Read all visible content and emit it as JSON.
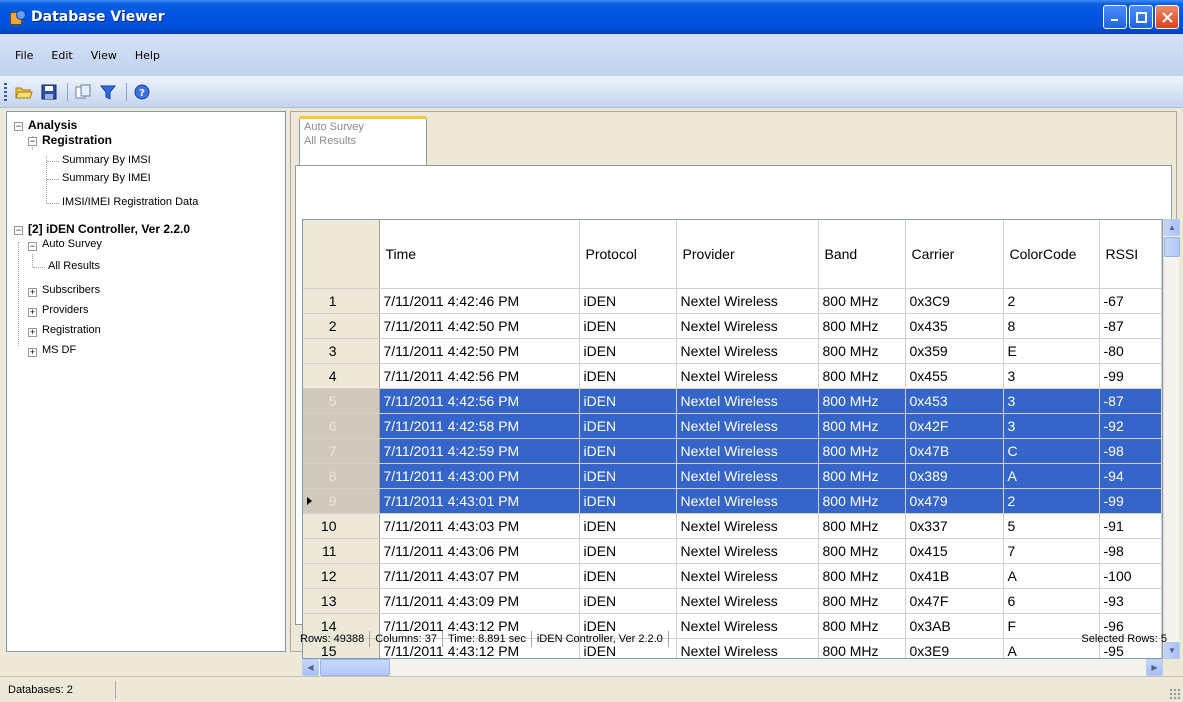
{
  "window": {
    "title": "Database Viewer",
    "minimize": "_",
    "maximize": "□",
    "close": "✕"
  },
  "menu": [
    "File",
    "Edit",
    "View",
    "Help"
  ],
  "toolbar": [
    "open-icon",
    "save-icon",
    "copy-icon",
    "filter-icon",
    "help-icon"
  ],
  "tree": {
    "analysis": "Analysis",
    "registration": "Registration",
    "summary_imsi": "Summary By IMSI",
    "summary_imei": "Summary By IMEI",
    "imsi_imei_reg": "IMSI/IMEI Registration Data",
    "controller": "[2]  iDEN Controller, Ver 2.2.0",
    "auto_survey": "Auto Survey",
    "all_results": "All Results",
    "subscribers": "Subscribers",
    "providers": "Providers",
    "registration2": "Registration",
    "ms_df": "MS DF"
  },
  "tab": {
    "line1": "Auto Survey",
    "line2": "All Results"
  },
  "grid": {
    "columns": [
      "Time",
      "Protocol",
      "Provider",
      "Band",
      "Carrier",
      "ColorCode",
      "RSSI"
    ],
    "rows": [
      {
        "n": "1",
        "time": "7/11/2011 4:42:46 PM",
        "protocol": "iDEN",
        "provider": "Nextel Wireless",
        "band": "800 MHz",
        "carrier": "0x3C9",
        "color": "2",
        "rssi": "-67",
        "selected": false
      },
      {
        "n": "2",
        "time": "7/11/2011 4:42:50 PM",
        "protocol": "iDEN",
        "provider": "Nextel Wireless",
        "band": "800 MHz",
        "carrier": "0x435",
        "color": "8",
        "rssi": "-87",
        "selected": false
      },
      {
        "n": "3",
        "time": "7/11/2011 4:42:50 PM",
        "protocol": "iDEN",
        "provider": "Nextel Wireless",
        "band": "800 MHz",
        "carrier": "0x359",
        "color": "E",
        "rssi": "-80",
        "selected": false
      },
      {
        "n": "4",
        "time": "7/11/2011 4:42:56 PM",
        "protocol": "iDEN",
        "provider": "Nextel Wireless",
        "band": "800 MHz",
        "carrier": "0x455",
        "color": "3",
        "rssi": "-99",
        "selected": false
      },
      {
        "n": "5",
        "time": "7/11/2011 4:42:56 PM",
        "protocol": "iDEN",
        "provider": "Nextel Wireless",
        "band": "800 MHz",
        "carrier": "0x453",
        "color": "3",
        "rssi": "-87",
        "selected": true
      },
      {
        "n": "6",
        "time": "7/11/2011 4:42:58 PM",
        "protocol": "iDEN",
        "provider": "Nextel Wireless",
        "band": "800 MHz",
        "carrier": "0x42F",
        "color": "3",
        "rssi": "-92",
        "selected": true
      },
      {
        "n": "7",
        "time": "7/11/2011 4:42:59 PM",
        "protocol": "iDEN",
        "provider": "Nextel Wireless",
        "band": "800 MHz",
        "carrier": "0x47B",
        "color": "C",
        "rssi": "-98",
        "selected": true
      },
      {
        "n": "8",
        "time": "7/11/2011 4:43:00 PM",
        "protocol": "iDEN",
        "provider": "Nextel Wireless",
        "band": "800 MHz",
        "carrier": "0x389",
        "color": "A",
        "rssi": "-94",
        "selected": true
      },
      {
        "n": "9",
        "time": "7/11/2011 4:43:01 PM",
        "protocol": "iDEN",
        "provider": "Nextel Wireless",
        "band": "800 MHz",
        "carrier": "0x479",
        "color": "2",
        "rssi": "-99",
        "selected": true,
        "current": true
      },
      {
        "n": "10",
        "time": "7/11/2011 4:43:03 PM",
        "protocol": "iDEN",
        "provider": "Nextel Wireless",
        "band": "800 MHz",
        "carrier": "0x337",
        "color": "5",
        "rssi": "-91",
        "selected": false
      },
      {
        "n": "11",
        "time": "7/11/2011 4:43:06 PM",
        "protocol": "iDEN",
        "provider": "Nextel Wireless",
        "band": "800 MHz",
        "carrier": "0x415",
        "color": "7",
        "rssi": "-98",
        "selected": false
      },
      {
        "n": "12",
        "time": "7/11/2011 4:43:07 PM",
        "protocol": "iDEN",
        "provider": "Nextel Wireless",
        "band": "800 MHz",
        "carrier": "0x41B",
        "color": "A",
        "rssi": "-100",
        "selected": false
      },
      {
        "n": "13",
        "time": "7/11/2011 4:43:09 PM",
        "protocol": "iDEN",
        "provider": "Nextel Wireless",
        "band": "800 MHz",
        "carrier": "0x47F",
        "color": "6",
        "rssi": "-93",
        "selected": false
      },
      {
        "n": "14",
        "time": "7/11/2011 4:43:12 PM",
        "protocol": "iDEN",
        "provider": "Nextel Wireless",
        "band": "800 MHz",
        "carrier": "0x3AB",
        "color": "F",
        "rssi": "-96",
        "selected": false
      },
      {
        "n": "15",
        "time": "7/11/2011 4:43:12 PM",
        "protocol": "iDEN",
        "provider": "Nextel Wireless",
        "band": "800 MHz",
        "carrier": "0x3E9",
        "color": "A",
        "rssi": "-95",
        "selected": false
      }
    ]
  },
  "grid_status": {
    "rows": "Rows: 49388",
    "columns": "Columns: 37",
    "time": "Time: 8.891 sec",
    "source": "iDEN Controller, Ver 2.2.0",
    "selected": "Selected Rows: 5"
  },
  "status": {
    "databases": "Databases: 2"
  },
  "colors": {
    "selection": "#3565c8",
    "title_bar": "#0054e3",
    "menu_bg": "#c8d8f2"
  }
}
